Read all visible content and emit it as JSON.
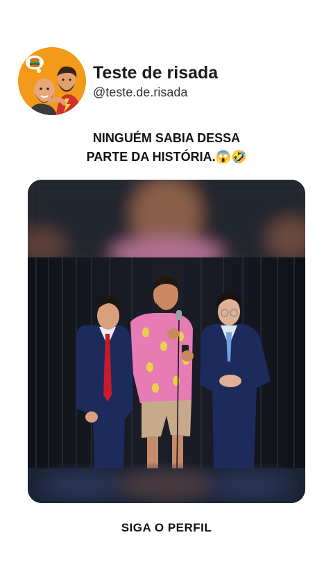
{
  "profile": {
    "display_name": "Teste de risada",
    "handle": "@teste.de.risada",
    "avatar_icon": "cartoon-duo-avatar-icon"
  },
  "post": {
    "caption_line1": "NINGUÉM SABIA DESSA",
    "caption_line2": "PARTE DA HISTÓRIA.😱🤣"
  },
  "video": {
    "description": ""
  },
  "footer": {
    "cta": "SIGA O PERFIL"
  },
  "colors": {
    "avatar_bg": "#f39a1a",
    "stage_curtain": "#14161d",
    "suit_navy": "#1c2a5c",
    "shirt_pink": "#e77bb3"
  }
}
